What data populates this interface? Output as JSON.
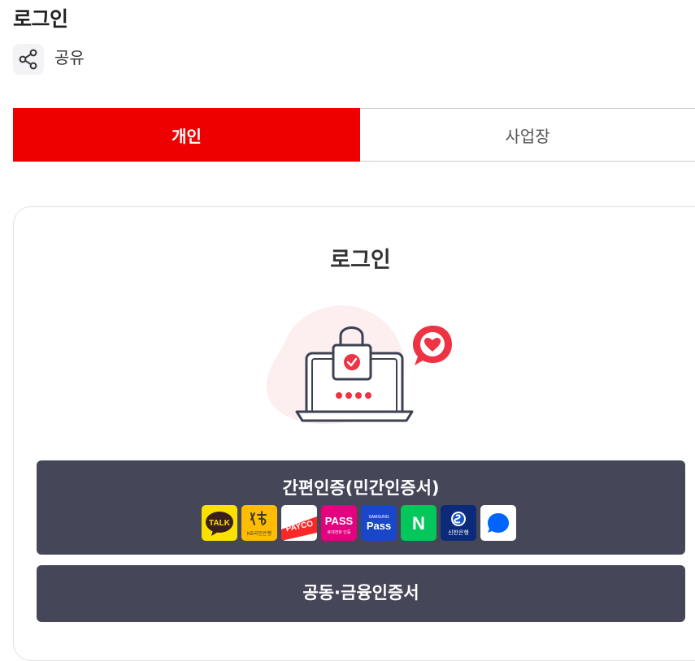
{
  "page": {
    "title": "로그인"
  },
  "share": {
    "label": "공유",
    "icon": "share-icon"
  },
  "tabs": [
    {
      "label": "개인",
      "active": true
    },
    {
      "label": "사업장",
      "active": false
    }
  ],
  "login_card": {
    "title": "로그인",
    "illustration": "laptop-lock-heart-illustration"
  },
  "auth_buttons": {
    "simple": {
      "label": "간편인증(민간인증서)",
      "providers": [
        {
          "name": "kakao-talk",
          "text": "TALK",
          "color": "#fae100"
        },
        {
          "name": "kb-bank",
          "text": "KB국민은행",
          "color": "#ffbc00"
        },
        {
          "name": "payco",
          "text": "PAYCO",
          "color": "#fa2828"
        },
        {
          "name": "pass",
          "text": "PASS",
          "subtext": "휴대전화 인증",
          "color": "#e4007f"
        },
        {
          "name": "samsung-pass",
          "text": "Pass",
          "subtext": "SAMSUNG",
          "color": "#1a47c9"
        },
        {
          "name": "naver",
          "text": "N",
          "color": "#03c75a"
        },
        {
          "name": "shinhan-bank",
          "text": "신한은행",
          "color": "#0b2a7a"
        },
        {
          "name": "toss",
          "text": "",
          "color": "#0064ff"
        }
      ]
    },
    "joint": {
      "label": "공동·금융인증서"
    }
  },
  "colors": {
    "accent": "#ee0000",
    "button_bg": "#454759"
  }
}
